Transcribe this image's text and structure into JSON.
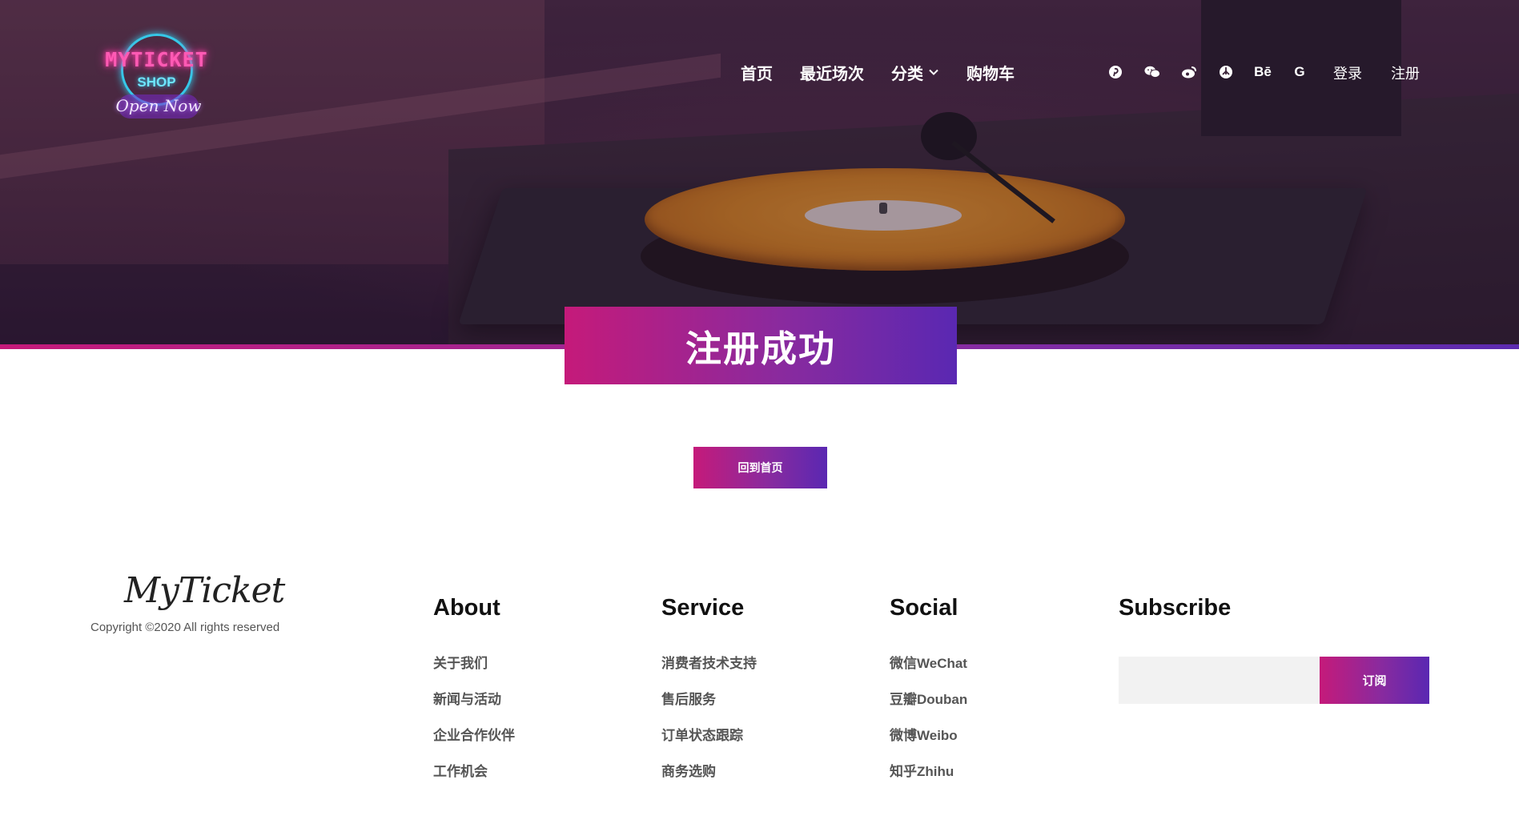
{
  "header": {
    "logo": {
      "word": "MYTICKET",
      "shop": "SHOP",
      "tagline": "Open Now"
    },
    "nav": [
      {
        "label": "首页"
      },
      {
        "label": "最近场次"
      },
      {
        "label": "分类",
        "has_dropdown": true
      },
      {
        "label": "购物车"
      }
    ],
    "social_icons": [
      {
        "icon": "pinterest-icon",
        "glyph": "℗"
      },
      {
        "icon": "wechat-icon"
      },
      {
        "icon": "weibo-icon"
      },
      {
        "icon": "douban-icon"
      },
      {
        "icon": "behance-icon",
        "glyph": "Bē"
      },
      {
        "icon": "google-icon",
        "glyph": "G"
      }
    ],
    "auth": {
      "login": "登录",
      "register": "注册"
    }
  },
  "hero": {
    "accent_from": "#c51a7a",
    "accent_to": "#5a28b2"
  },
  "main": {
    "title": "注册成功",
    "back_home": "回到首页"
  },
  "footer": {
    "brand": "MyTicket",
    "copyright": "Copyright ©2020 All rights reserved",
    "columns": [
      {
        "title": "About",
        "items": [
          "关于我们",
          "新闻与活动",
          "企业合作伙伴",
          "工作机会"
        ]
      },
      {
        "title": "Service",
        "items": [
          "消费者技术支持",
          "售后服务",
          "订单状态跟踪",
          "商务选购"
        ]
      },
      {
        "title": "Social",
        "items": [
          "微信WeChat",
          "豆瓣Douban",
          "微博Weibo",
          "知乎Zhihu"
        ]
      }
    ],
    "subscribe": {
      "title": "Subscribe",
      "placeholder": "",
      "button": "订阅"
    }
  }
}
